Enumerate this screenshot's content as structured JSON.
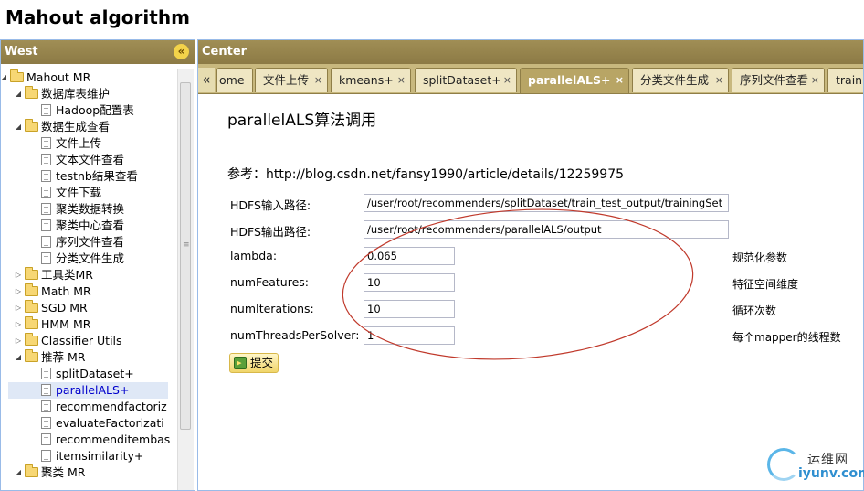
{
  "app": {
    "title": "Mahout algorithm"
  },
  "west": {
    "title": "West",
    "collapse_glyph": "«",
    "tree": [
      {
        "label": "Mahout MR",
        "type": "folder",
        "level": 0,
        "expanded": true
      },
      {
        "label": "数据库表维护",
        "type": "folder",
        "level": 1,
        "expanded": true
      },
      {
        "label": "Hadoop配置表",
        "type": "doc",
        "level": 2
      },
      {
        "label": "数据生成查看",
        "type": "folder",
        "level": 1,
        "expanded": true
      },
      {
        "label": "文件上传",
        "type": "doc",
        "level": 2
      },
      {
        "label": "文本文件查看",
        "type": "doc",
        "level": 2
      },
      {
        "label": "testnb结果查看",
        "type": "doc",
        "level": 2
      },
      {
        "label": "文件下载",
        "type": "doc",
        "level": 2
      },
      {
        "label": "聚类数据转换",
        "type": "doc",
        "level": 2
      },
      {
        "label": "聚类中心查看",
        "type": "doc",
        "level": 2
      },
      {
        "label": "序列文件查看",
        "type": "doc",
        "level": 2
      },
      {
        "label": "分类文件生成",
        "type": "doc",
        "level": 2
      },
      {
        "label": "工具类MR",
        "type": "folder",
        "level": 1,
        "expanded": false
      },
      {
        "label": "Math MR",
        "type": "folder",
        "level": 1,
        "expanded": false
      },
      {
        "label": "SGD MR",
        "type": "folder",
        "level": 1,
        "expanded": false
      },
      {
        "label": "HMM MR",
        "type": "folder",
        "level": 1,
        "expanded": false
      },
      {
        "label": "Classifier Utils",
        "type": "folder",
        "level": 1,
        "expanded": false
      },
      {
        "label": "推荐 MR",
        "type": "folder",
        "level": 1,
        "expanded": true
      },
      {
        "label": "splitDataset+",
        "type": "doc",
        "level": 2
      },
      {
        "label": "parallelALS+",
        "type": "doc",
        "level": 2,
        "selected": true
      },
      {
        "label": "recommendfactoriz",
        "type": "doc",
        "level": 2
      },
      {
        "label": "evaluateFactorizati",
        "type": "doc",
        "level": 2
      },
      {
        "label": "recommenditembas",
        "type": "doc",
        "level": 2
      },
      {
        "label": "itemsimilarity+",
        "type": "doc",
        "level": 2
      },
      {
        "label": "聚类 MR",
        "type": "folder",
        "level": 1,
        "expanded": true
      }
    ]
  },
  "center": {
    "title": "Center",
    "scroll_left_glyph": "«",
    "close_glyph": "×",
    "tabs": [
      {
        "label": "ome",
        "closable": false
      },
      {
        "label": "文件上传",
        "closable": true
      },
      {
        "label": "kmeans+",
        "closable": true
      },
      {
        "label": "splitDataset+",
        "closable": true
      },
      {
        "label": "parallelALS+",
        "closable": true,
        "active": true
      },
      {
        "label": "分类文件生成",
        "closable": true
      },
      {
        "label": "序列文件查看",
        "closable": true
      },
      {
        "label": "trainn",
        "closable": false
      }
    ],
    "page_title": "parallelALS算法调用",
    "reference": "参考：http://blog.csdn.net/fansy1990/article/details/12259975",
    "form": {
      "input_path": {
        "label": "HDFS输入路径:",
        "value": "/user/root/recommenders/splitDataset/train_test_output/trainingSet"
      },
      "output_path": {
        "label": "HDFS输出路径:",
        "value": "/user/root/recommenders/parallelALS/output"
      },
      "lambda": {
        "label": "lambda:",
        "value": "0.065",
        "note": "规范化参数"
      },
      "num_features": {
        "label": "numFeatures:",
        "value": "10",
        "note": "特征空间维度"
      },
      "num_iterations": {
        "label": "numIterations:",
        "value": "10",
        "note": "循环次数"
      },
      "num_threads": {
        "label": "numThreadsPerSolver:",
        "value": "1",
        "note": "每个mapper的线程数"
      }
    },
    "submit_label": "提交"
  },
  "watermark": {
    "top_text": "运维网",
    "bottom_text": "iyunv.com",
    "color": "#2f8fd0"
  },
  "colors": {
    "panel_header": "#8c7a45",
    "active_tab": "#b8a565",
    "annotation_ellipse": "#c0392b"
  }
}
